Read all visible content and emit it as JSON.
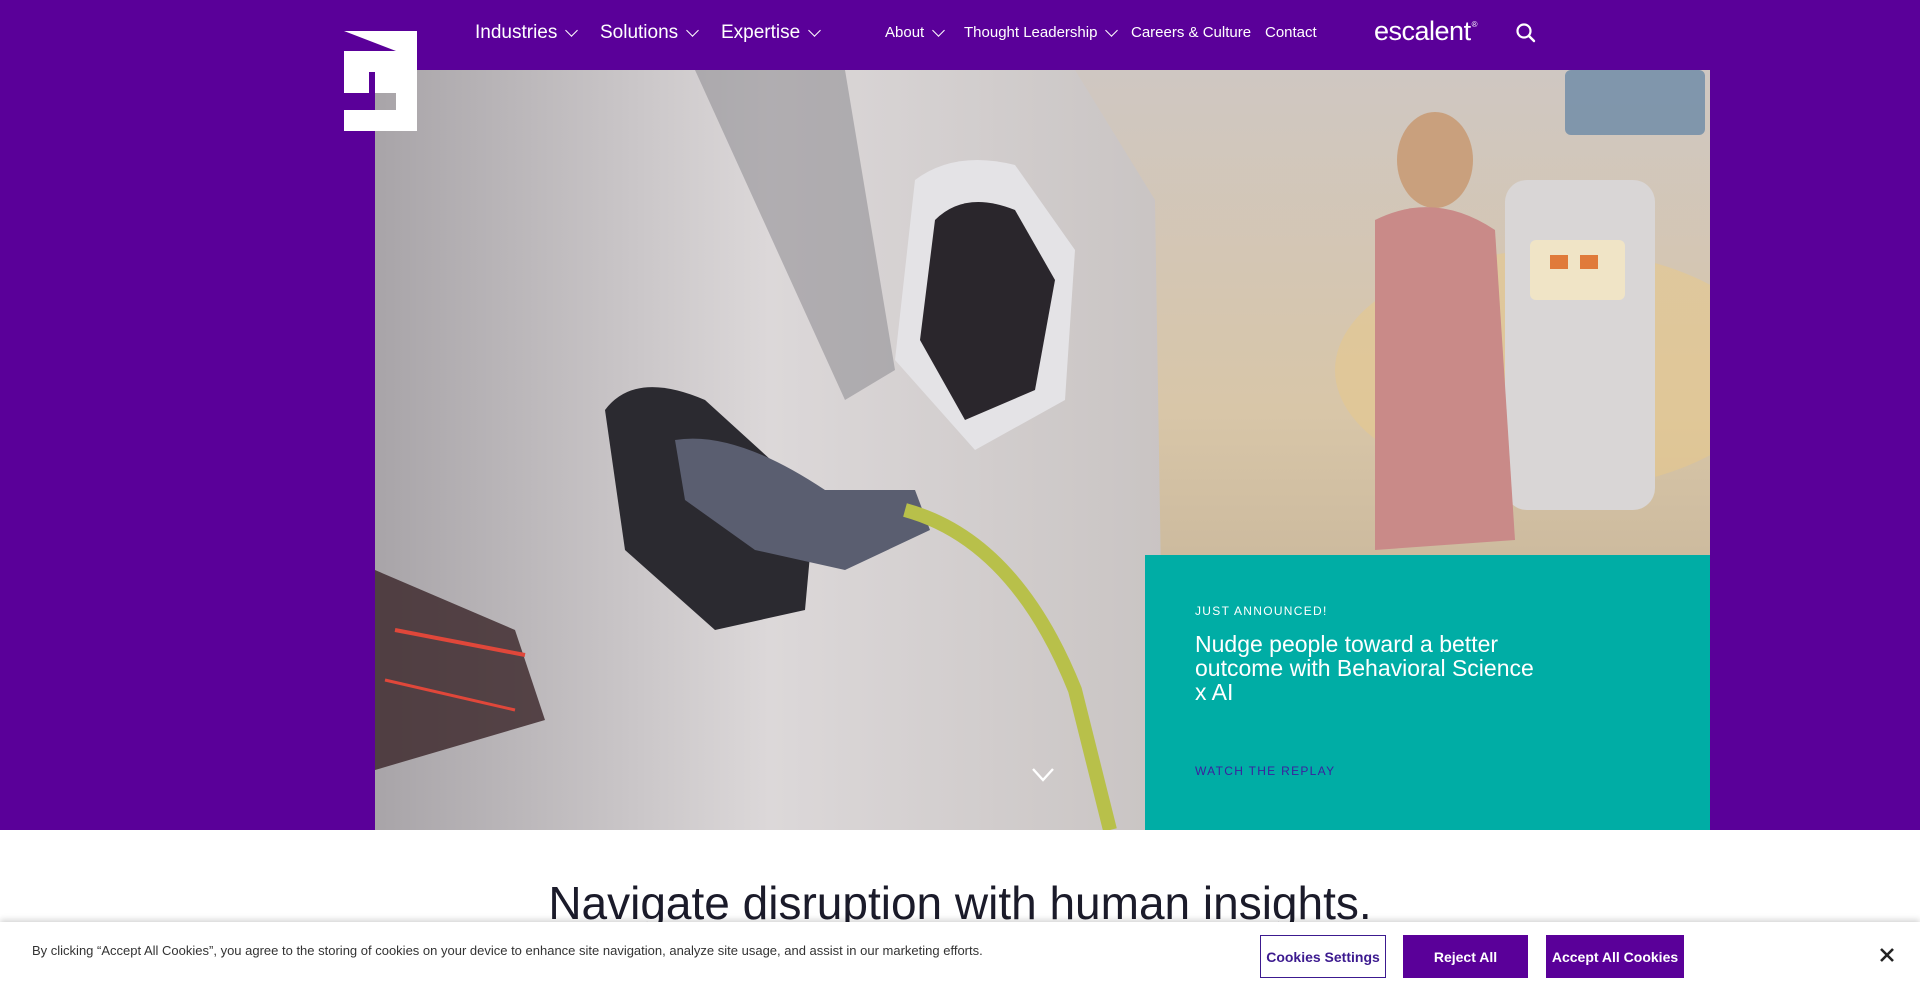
{
  "colors": {
    "brand_purple": "#5a0099",
    "teal": "#00ada5",
    "link_purple": "#3d1f9e"
  },
  "nav": {
    "primary": [
      {
        "label": "Industries"
      },
      {
        "label": "Solutions"
      },
      {
        "label": "Expertise"
      }
    ],
    "secondary": [
      {
        "label": "About"
      },
      {
        "label": "Thought Leadership"
      },
      {
        "label": "Careers & Culture"
      },
      {
        "label": "Contact"
      }
    ],
    "brand": "escalent",
    "brand_mark": "®",
    "icons": {
      "search": "search-icon",
      "chevron": "chevron-down-icon",
      "logo": "escalent-e-logo"
    }
  },
  "hero": {
    "image_subject": "electric vehicle charging",
    "card": {
      "eyebrow": "JUST ANNOUNCED!",
      "title": "Nudge people toward a better outcome with Behavioral Science x AI",
      "link": "WATCH THE REPLAY"
    }
  },
  "main": {
    "headline": "Navigate disruption with human insights."
  },
  "cookie_banner": {
    "text": "By clicking “Accept All Cookies”, you agree to the storing of cookies on your device to enhance site navigation, analyze site usage, and assist in our marketing efforts.",
    "settings_label": "Cookies Settings",
    "reject_label": "Reject All",
    "accept_label": "Accept All Cookies",
    "close_icon": "close-icon"
  }
}
